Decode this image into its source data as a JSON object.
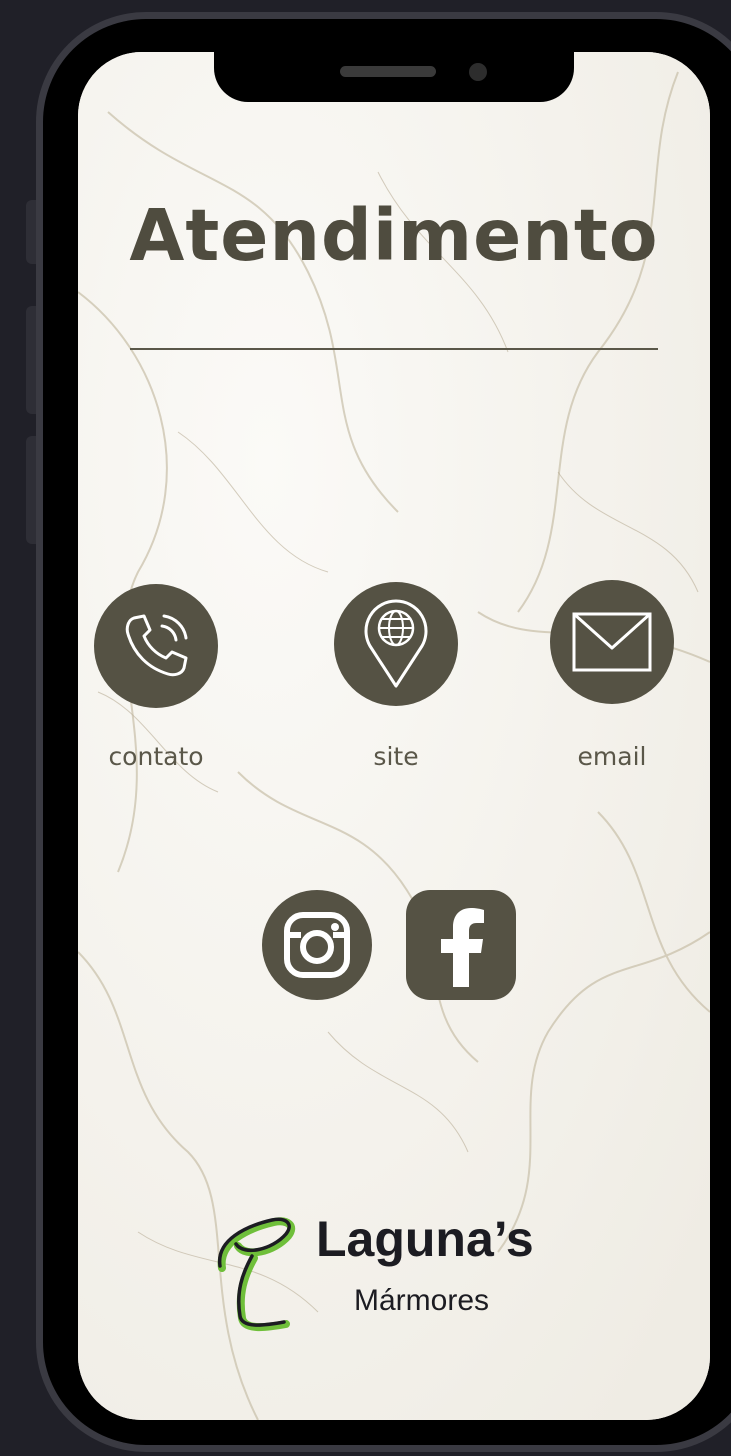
{
  "page": {
    "title": "Atendimento"
  },
  "actions": [
    {
      "id": "contato",
      "label": "contato",
      "icon": "phone-icon"
    },
    {
      "id": "site",
      "label": "site",
      "icon": "globe-pin-icon"
    },
    {
      "id": "email",
      "label": "email",
      "icon": "envelope-icon"
    }
  ],
  "social": [
    {
      "id": "instagram",
      "icon": "instagram-icon"
    },
    {
      "id": "facebook",
      "icon": "facebook-icon"
    }
  ],
  "brand": {
    "name": "Laguna’s",
    "subtitle": "Mármores"
  },
  "colors": {
    "accent": "#555244",
    "title": "#4f4c3f",
    "background": "#f6f4ef",
    "frame": "#000000",
    "logo_green": "#6fbf3a"
  }
}
